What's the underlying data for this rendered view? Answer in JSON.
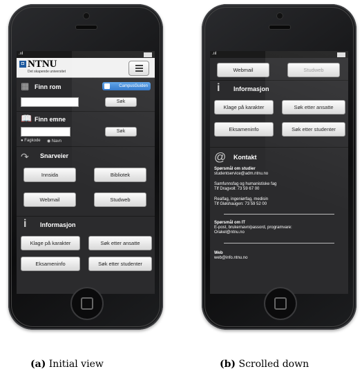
{
  "phone_a": {
    "logo": "NTNU",
    "logo_sub": "Det skapende universitet",
    "find_room": {
      "title": "Finn rom",
      "campus_guide": "CampusGuiden",
      "search_label": "Søk"
    },
    "find_course": {
      "title": "Finn emne",
      "search_label": "Søk",
      "radio_1": "Fagkode",
      "radio_2": "Navn"
    },
    "shortcuts": {
      "title": "Snarveier",
      "btn1": "Innsida",
      "btn2": "Bibliotek",
      "btn3": "Webmail",
      "btn4": "Studweb"
    },
    "info": {
      "title": "Informasjon",
      "btn1": "Klage på karakter",
      "btn2": "Søk etter ansatte",
      "btn3": "Eksameninfo",
      "btn4": "Søk etter studenter"
    }
  },
  "phone_b": {
    "top_btn1": "Webmail",
    "top_btn2": "Studweb",
    "info": {
      "title": "Informasjon",
      "btn1": "Klage på karakter",
      "btn2": "Søk etter ansatte",
      "btn3": "Eksameninfo",
      "btn4": "Søk etter studenter"
    },
    "contact": {
      "title": "Kontakt",
      "studies_label": "Spørsmål om studier",
      "studies_email": "studentservice@adm.ntnu.no",
      "line1": "Samfunnsfag og humanistiske fag",
      "line2": "Tlf Dragvoll: 73 59 67 00",
      "line3": "Realfag, ingeniørfag, medisin",
      "line4": "Tlf Gløshaugen: 73 59 52 00",
      "it_label": "Spørsmål om IT",
      "it_line1": "E-post, brukernavn/passord, programvare:",
      "it_line2": "Orakel@ntnu.no",
      "web_label": "Web",
      "web_email": "web@info.ntnu.no"
    }
  },
  "captions": {
    "a_label": "(a)",
    "a_text": "Initial view",
    "b_label": "(b)",
    "b_text": "Scrolled down"
  }
}
